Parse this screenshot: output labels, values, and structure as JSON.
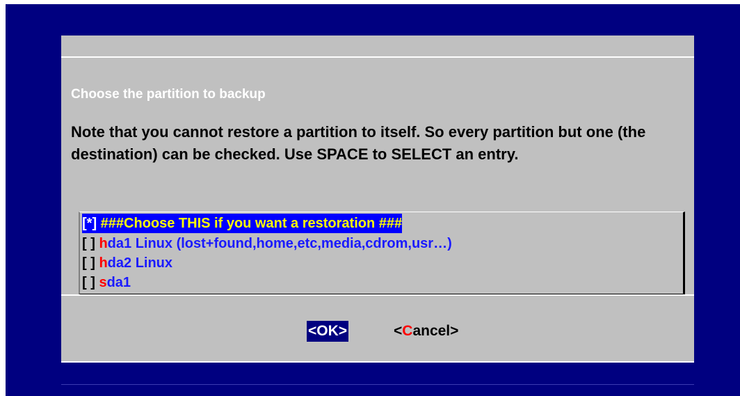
{
  "dialog": {
    "title": "Choose the partition to backup",
    "note": "Note that you cannot restore a partition to itself. So every partition but one (the destination) can be checked. Use SPACE to SELECT an entry."
  },
  "list": {
    "items": [
      {
        "check": "[*]",
        "hotkey": "",
        "rest": " ###Choose THIS if you want a restoration ###",
        "selected": true
      },
      {
        "check": "[ ]",
        "hotkey": "h",
        "rest": "da1 Linux (lost+found,home,etc,media,cdrom,usr…)",
        "selected": false
      },
      {
        "check": "[ ]",
        "hotkey": "h",
        "rest": "da2 Linux",
        "selected": false
      },
      {
        "check": "[ ]",
        "hotkey": "s",
        "rest": "da1",
        "selected": false
      }
    ]
  },
  "buttons": {
    "ok_label": "<OK>",
    "cancel_prefix": "<",
    "cancel_hotkey": "C",
    "cancel_suffix": "ancel>"
  },
  "colors": {
    "screen_background": "#000080",
    "dialog_background": "#c0c0c0",
    "selection_background": "#0000ff",
    "selection_text": "#ffff00",
    "item_text": "#1a1aff",
    "hotkey": "#ff0000"
  }
}
